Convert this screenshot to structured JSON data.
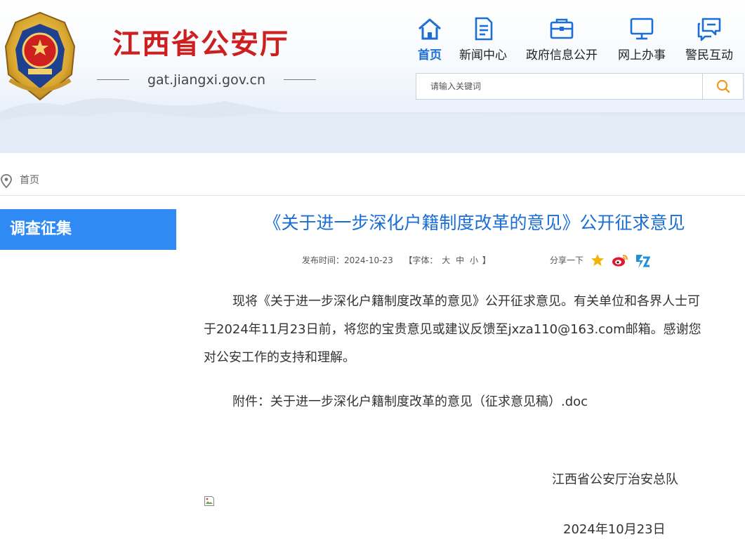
{
  "header": {
    "title": "江西省公安厅",
    "domain": "gat.jiangxi.gov.cn"
  },
  "nav": [
    {
      "label": "首页",
      "icon": "home-icon",
      "active": true
    },
    {
      "label": "新闻中心",
      "icon": "document-icon",
      "active": false
    },
    {
      "label": "政府信息公开",
      "icon": "folder-icon",
      "active": false
    },
    {
      "label": "网上办事",
      "icon": "monitor-icon",
      "active": false
    },
    {
      "label": "警民互动",
      "icon": "chat-icon",
      "active": false
    }
  ],
  "search": {
    "placeholder": "请输入关键词",
    "icon": "search-icon"
  },
  "breadcrumb": {
    "icon": "location-pin-icon",
    "home": "首页"
  },
  "sidebar": {
    "title": "调查征集"
  },
  "article": {
    "title": "《关于进一步深化户籍制度改革的意见》公开征求意见",
    "publish_label": "发布时间：",
    "publish_date": "2024-10-23",
    "font_label_open": "【字体：",
    "font_large": "大",
    "font_medium": "中",
    "font_small": "小",
    "font_label_close": "】",
    "share_label": "分享一下",
    "share_icons": [
      "star-icon",
      "weibo-icon",
      "qzone-icon"
    ],
    "paragraph_line1": "现将《关于进一步深化户籍制度改革的意见》公开征求意见。有关单位和各界人士可",
    "paragraph_line2": "于2024年11月23日前，将您的宝贵意见或建议反馈至jxza110@163.com邮箱。感谢您",
    "paragraph_line3": "对公安工作的支持和理解。",
    "attachment": "附件：关于进一步深化户籍制度改革的意见（征求意见稿）.doc",
    "signature": "江西省公安厅治安总队",
    "sign_date": "2024年10月23日"
  },
  "colors": {
    "brand_red": "#cc1f1f",
    "accent_blue": "#1a6ed4",
    "sidebar_blue": "#2f8bf3"
  }
}
